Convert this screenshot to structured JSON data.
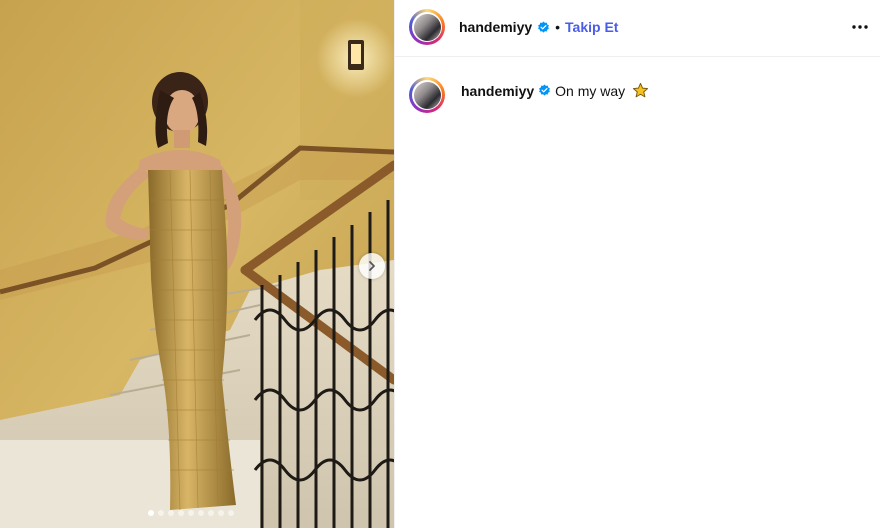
{
  "post": {
    "author": "handemiyy",
    "verified": true,
    "follow_separator": "•",
    "follow_label": "Takip Et",
    "more_icon": "more-horizontal-icon",
    "caption": "On my way",
    "caption_emoji": "star-emoji",
    "carousel": {
      "total_slides": 9,
      "current_slide": 1,
      "next_icon": "chevron-right-icon"
    }
  },
  "colors": {
    "follow": "#4a5de8",
    "verified_badge": "#0095f6",
    "wall": "#c9a44f",
    "dress": "#b8913f"
  }
}
